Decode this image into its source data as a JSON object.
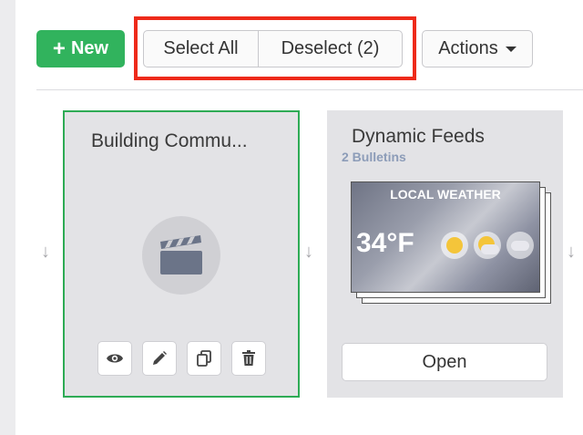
{
  "toolbar": {
    "new_label": "New",
    "select_all_label": "Select All",
    "deselect_label": "Deselect (2)",
    "actions_label": "Actions"
  },
  "cards": [
    {
      "title": "Building Commu...",
      "icons": [
        "clapperboard-icon",
        "eye-icon",
        "pencil-icon",
        "copy-icon",
        "trash-icon"
      ]
    },
    {
      "title": "Dynamic Feeds",
      "subtitle": "2 Bulletins",
      "thumbnail": {
        "heading": "LOCAL WEATHER",
        "temperature": "34°F"
      },
      "open_label": "Open"
    }
  ],
  "colors": {
    "accent_green": "#31b35d",
    "selected_border": "#2eab55",
    "highlight_red": "#ee2a1a",
    "subtitle_blue": "#8c9cb8"
  }
}
